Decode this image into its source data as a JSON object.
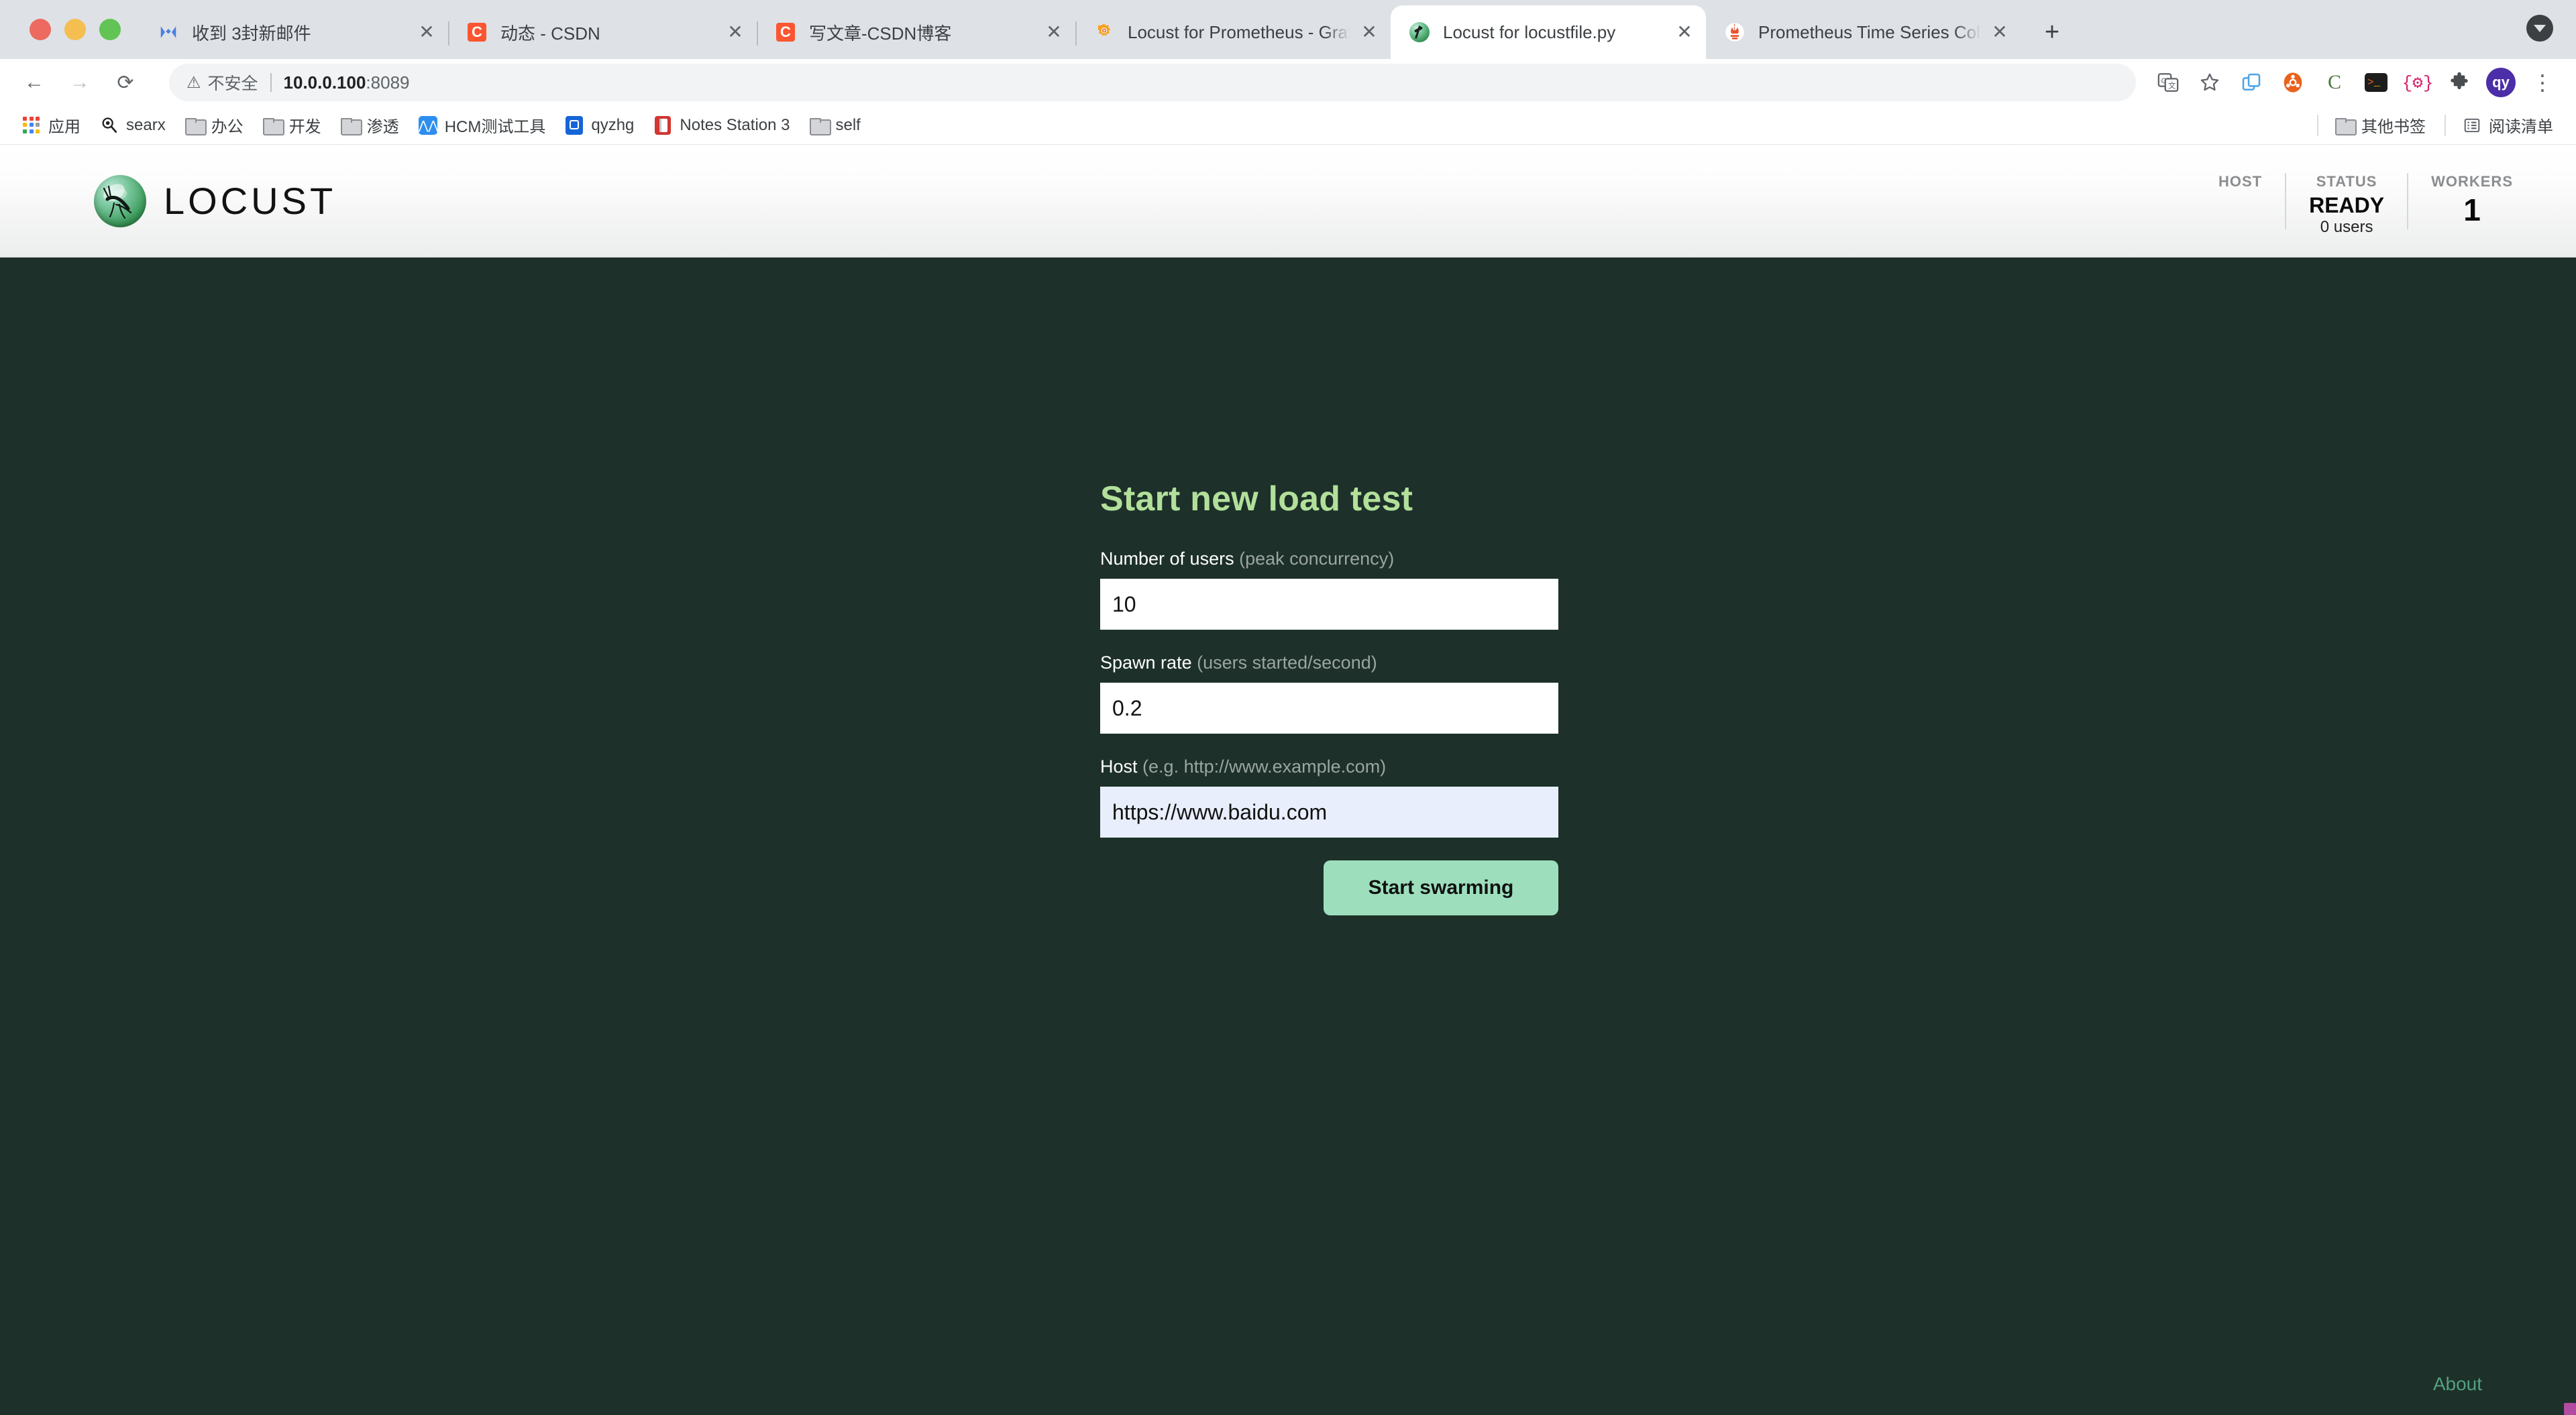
{
  "browser": {
    "window_controls": [
      "close",
      "minimize",
      "maximize"
    ],
    "tabs": [
      {
        "title": "收到 3封新邮件",
        "favicon": "mail-icon",
        "active": false,
        "close_label": "✕"
      },
      {
        "title": "动态 - CSDN",
        "favicon": "csdn-icon",
        "active": false,
        "close_label": "✕"
      },
      {
        "title": "写文章-CSDN博客",
        "favicon": "csdn-icon",
        "active": false,
        "close_label": "✕"
      },
      {
        "title": "Locust for Prometheus - Grafan",
        "favicon": "grafana-icon",
        "active": false,
        "close_label": "✕"
      },
      {
        "title": "Locust for locustfile.py",
        "favicon": "locust-icon",
        "active": true,
        "close_label": "✕"
      },
      {
        "title": "Prometheus Time Series Collec",
        "favicon": "prometheus-icon",
        "active": false,
        "close_label": "✕"
      }
    ],
    "new_tab_label": "+",
    "tab_list_label": "▼",
    "toolbar": {
      "back_label": "←",
      "forward_label": "→",
      "reload_label": "⟳",
      "security_icon": "warning-triangle-icon",
      "security_text": "不安全",
      "url_bold": "10.0.0.100",
      "url_rest": ":8089",
      "extensions": [
        {
          "name": "translate-icon",
          "glyph": "文"
        },
        {
          "name": "bookmark-star-icon",
          "glyph": "☆"
        },
        {
          "name": "tab-copy-icon",
          "glyph": "❐"
        },
        {
          "name": "ubuntu-icon",
          "glyph": "◉"
        },
        {
          "name": "csdn-c-icon",
          "glyph": "C"
        },
        {
          "name": "terminal-icon",
          "glyph": ">_"
        },
        {
          "name": "json-viewer-icon",
          "glyph": "{⚙}"
        },
        {
          "name": "puzzle-extensions-icon",
          "glyph": "🧩"
        },
        {
          "name": "profile-avatar",
          "glyph": "qy"
        },
        {
          "name": "chrome-menu-icon",
          "glyph": "⋮"
        }
      ]
    },
    "bookmarks": [
      {
        "label": "应用",
        "icon": "apps-grid-icon"
      },
      {
        "label": "searx",
        "icon": "searx-icon"
      },
      {
        "label": "办公",
        "icon": "folder-icon"
      },
      {
        "label": "开发",
        "icon": "folder-icon"
      },
      {
        "label": "渗透",
        "icon": "folder-icon"
      },
      {
        "label": "HCM测试工具",
        "icon": "hcm-icon"
      },
      {
        "label": "qyzhg",
        "icon": "qyzhg-icon"
      },
      {
        "label": "Notes Station 3",
        "icon": "notes-station-icon"
      },
      {
        "label": "self",
        "icon": "folder-icon"
      }
    ],
    "bookmarks_right": [
      {
        "label": "其他书签",
        "icon": "folder-icon"
      },
      {
        "label": "阅读清单",
        "icon": "reading-list-icon"
      }
    ]
  },
  "app": {
    "brand_name": "LOCUST",
    "status": {
      "host": {
        "label": "HOST",
        "value": ""
      },
      "state": {
        "label": "STATUS",
        "value": "READY",
        "sub": "0 users"
      },
      "workers": {
        "label": "WORKERS",
        "value": "1"
      }
    },
    "form": {
      "title": "Start new load test",
      "fields": [
        {
          "label": "Number of users",
          "hint": "(peak concurrency)",
          "value": "10",
          "placeholder": "",
          "autofill": false
        },
        {
          "label": "Spawn rate",
          "hint": "(users started/second)",
          "value": "0.2",
          "placeholder": "",
          "autofill": false
        },
        {
          "label": "Host",
          "hint": "(e.g. http://www.example.com)",
          "value": "https://www.baidu.com",
          "placeholder": "",
          "autofill": true
        }
      ],
      "submit_label": "Start swarming"
    },
    "footer": {
      "about_label": "About"
    },
    "colors": {
      "page_background": "#1d302a",
      "accent_title": "#b2e09a",
      "button": "#9ddfbd",
      "about_link": "#53a080",
      "autofill_field": "#e8eefb"
    }
  }
}
